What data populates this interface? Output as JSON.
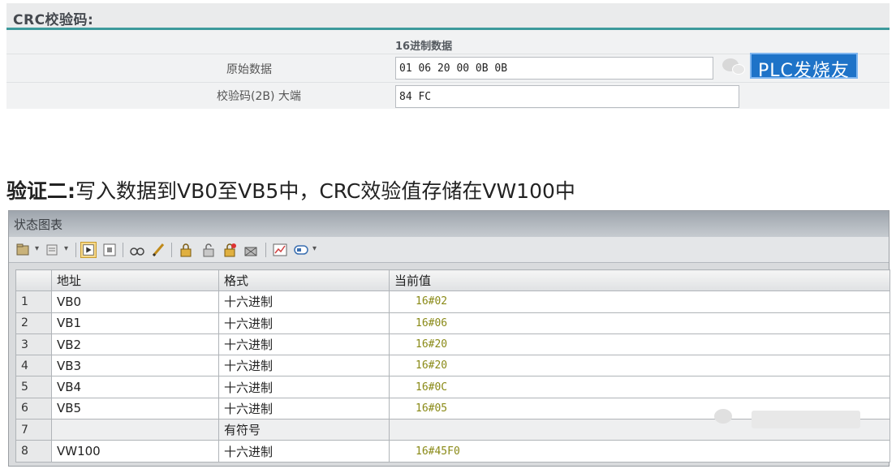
{
  "crc_panel": {
    "title": "CRC校验码:",
    "column_header": "16进制数据",
    "rows": [
      {
        "label": "原始数据",
        "value": "01 06 20 00 0B 0B"
      },
      {
        "label": "校验码(2B)  大端",
        "value": "84 FC"
      }
    ],
    "watermark_text": "PLC发烧友"
  },
  "heading": {
    "bold_part": "验证二:",
    "rest": "写入数据到VB0至VB5中，CRC效验值存储在VW100中"
  },
  "status_chart": {
    "window_title": "状态图表",
    "toolbar_icons": [
      "new-table-icon",
      "insert-icon",
      "play-icon",
      "stop-icon",
      "glasses-icon",
      "pencil-icon",
      "lock-icon",
      "unlock-icon",
      "force-icon",
      "unforce-icon",
      "trend-icon",
      "comment-icon"
    ],
    "columns": [
      "地址",
      "格式",
      "当前值"
    ],
    "rows": [
      {
        "index": "1",
        "address": "VB0",
        "format": "十六进制",
        "value": "16#02"
      },
      {
        "index": "2",
        "address": "VB1",
        "format": "十六进制",
        "value": "16#06"
      },
      {
        "index": "3",
        "address": "VB2",
        "format": "十六进制",
        "value": "16#20"
      },
      {
        "index": "4",
        "address": "VB3",
        "format": "十六进制",
        "value": "16#20"
      },
      {
        "index": "5",
        "address": "VB4",
        "format": "十六进制",
        "value": "16#0C"
      },
      {
        "index": "6",
        "address": "VB5",
        "format": "十六进制",
        "value": "16#05"
      },
      {
        "index": "7",
        "address": "",
        "format": "有符号",
        "value": ""
      },
      {
        "index": "8",
        "address": "VW100",
        "format": "十六进制",
        "value": "16#45F0"
      }
    ]
  },
  "colors": {
    "accent_teal": "#3d9a9c",
    "watermark_blue": "#1e73c8",
    "value_text": "#8a8a17"
  }
}
